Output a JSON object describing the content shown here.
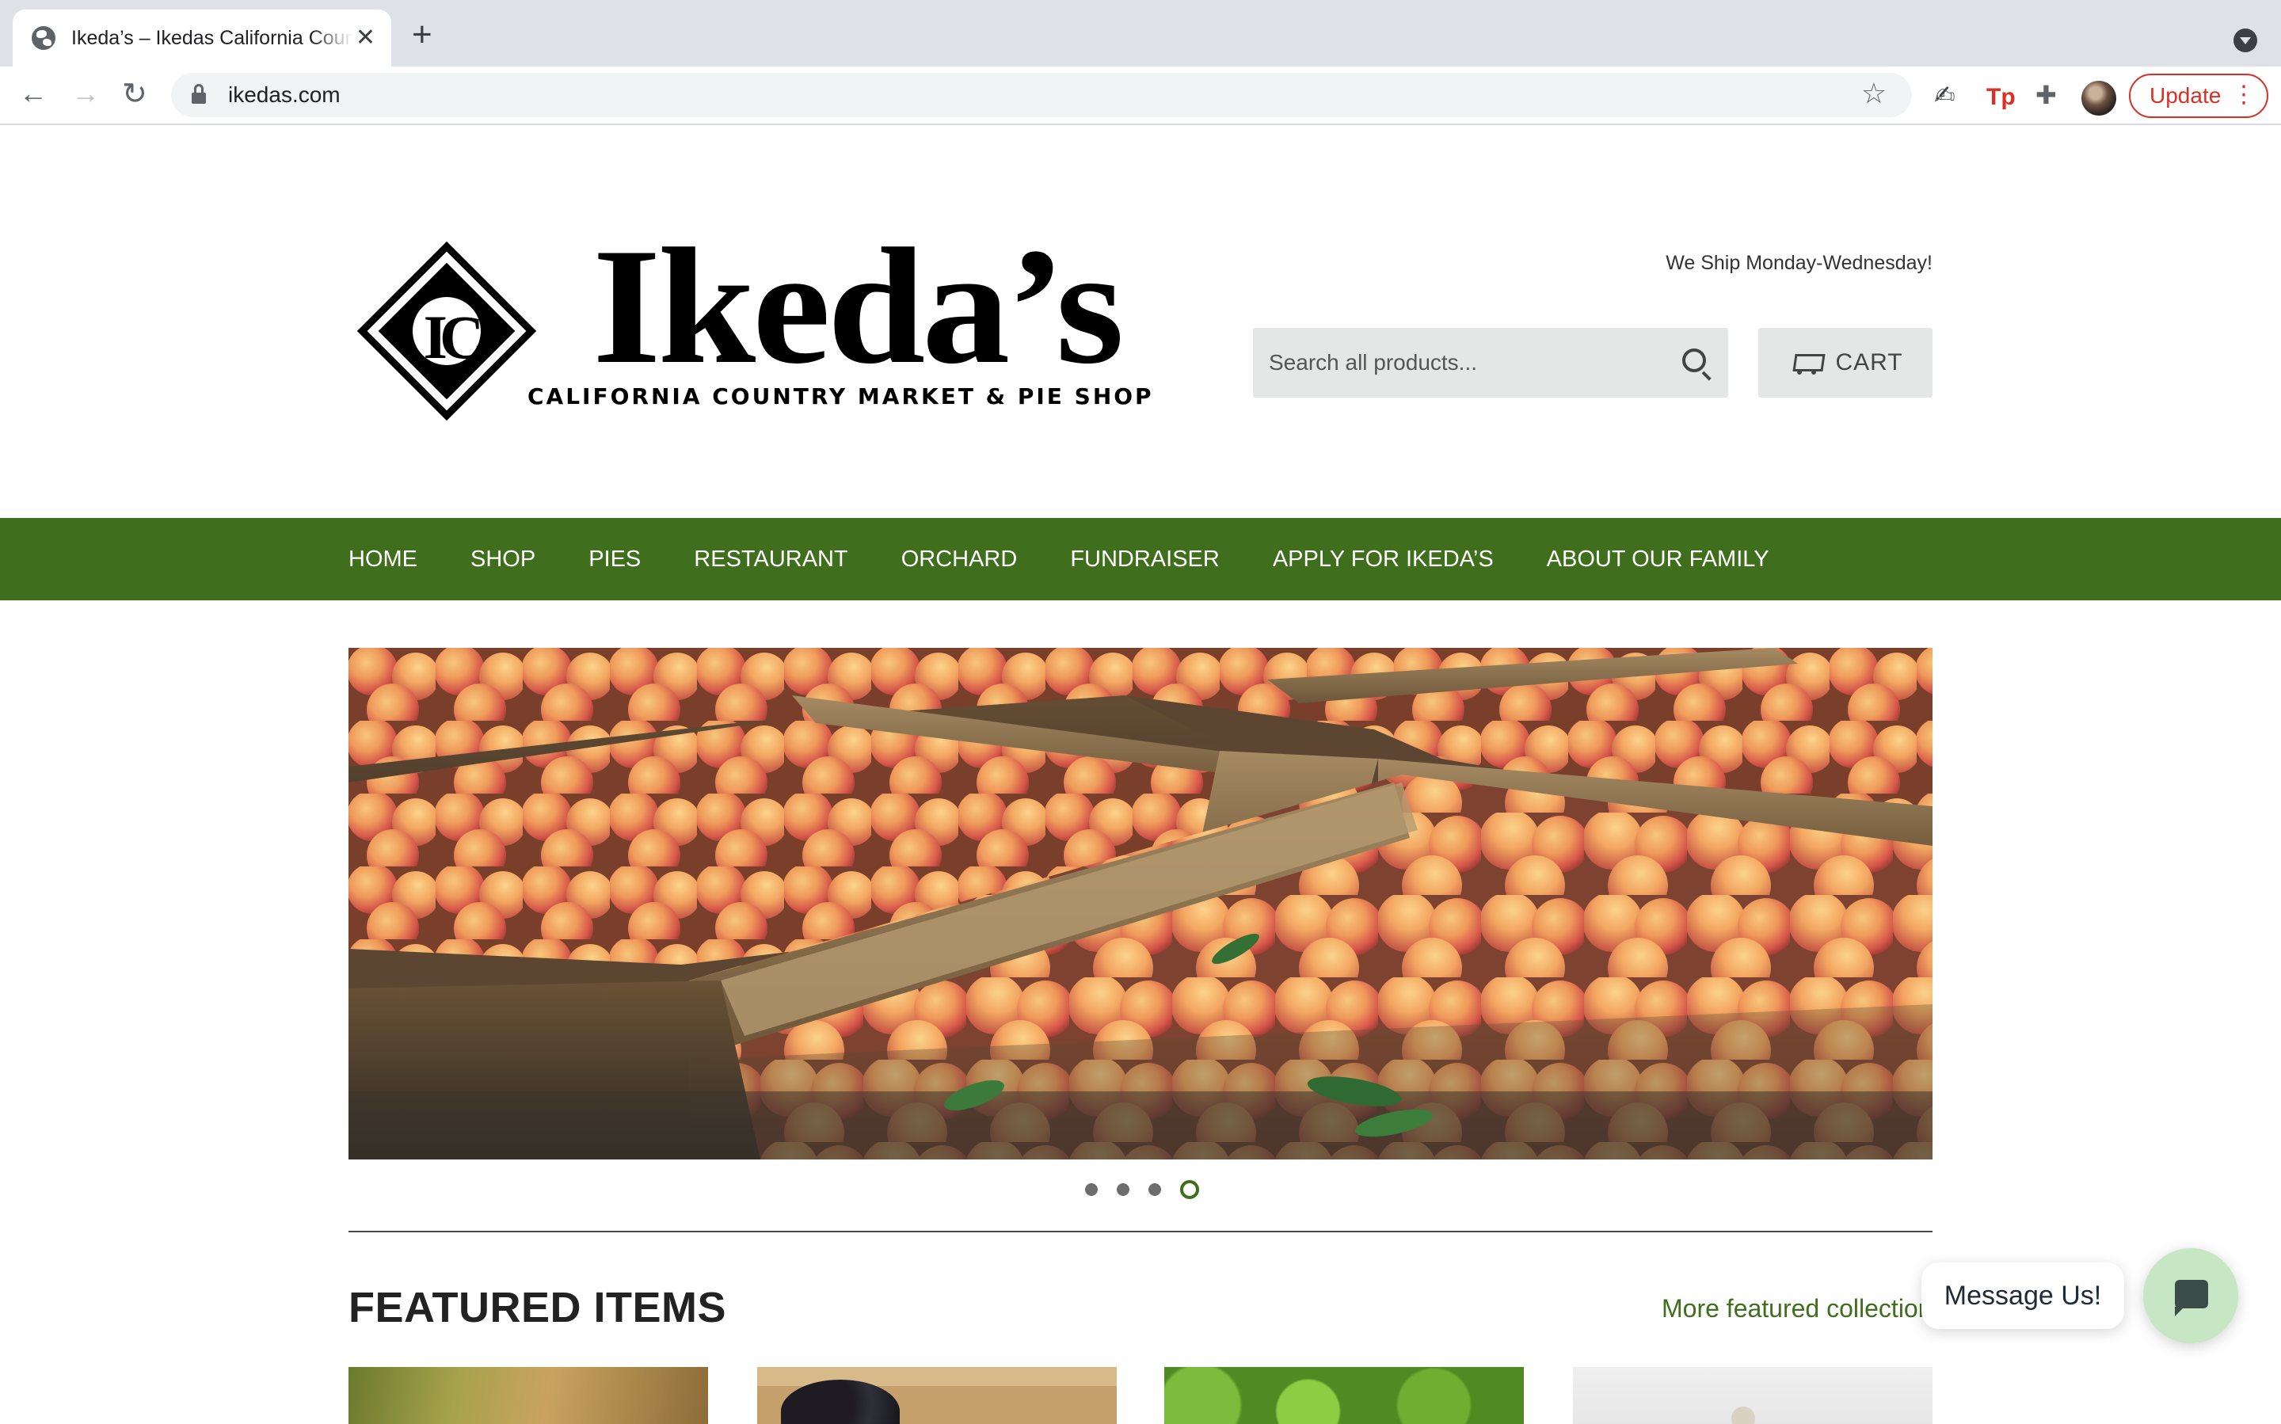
{
  "browser": {
    "tab_title": "Ikeda’s – Ikedas California Country Market & Pie Shop",
    "url": "ikedas.com",
    "update_label": "Update",
    "icons": [
      "globe-icon",
      "close-icon",
      "plus-icon",
      "back-icon",
      "forward-icon",
      "reload-icon",
      "lock-icon",
      "star-icon",
      "extensions-icon"
    ]
  },
  "header": {
    "logo_name": "Ikeda’s",
    "logo_initials": "IC",
    "logo_tagline": "CALIFORNIA COUNTRY MARKET & PIE SHOP",
    "ship_notice": "We Ship Monday-Wednesday!",
    "search_placeholder": "Search all products...",
    "cart_label": "CART"
  },
  "nav": {
    "items": [
      "HOME",
      "SHOP",
      "PIES",
      "RESTAURANT",
      "ORCHARD",
      "FUNDRAISER",
      "APPLY FOR IKEDA’S",
      "ABOUT OUR FAMILY"
    ]
  },
  "slideshow": {
    "slide_count": 4,
    "active_slide": 4
  },
  "featured": {
    "title": "FEATURED ITEMS",
    "more_link": "More featured collection"
  },
  "chat": {
    "bubble_label": "Message Us!"
  },
  "colors": {
    "brand_green": "#3f6e1d",
    "update_red": "#d93025",
    "chat_green": "#c6e6c4"
  }
}
